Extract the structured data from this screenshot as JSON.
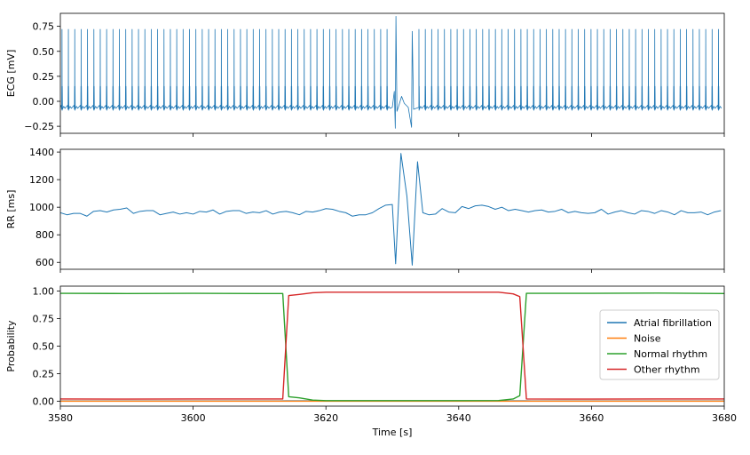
{
  "chart_data": [
    {
      "type": "line",
      "ylabel": "ECG [mV]",
      "xlim": [
        3580,
        3680
      ],
      "ylim": [
        -0.32,
        0.88
      ],
      "yticks": [
        -0.25,
        0.0,
        0.25,
        0.5,
        0.75
      ],
      "ytick_labels": [
        "−0.25",
        "0.00",
        "0.25",
        "0.50",
        "0.75"
      ],
      "color": "#1f77b4",
      "beat_interval_s": 0.96,
      "r_peak_mV": 0.72,
      "qrs_low_mV": 0.15,
      "baseline_mV": -0.06,
      "artifact_window_s": [
        3630,
        3634
      ],
      "artifact_peaks_mV": [
        0.85,
        -0.27,
        -0.26
      ]
    },
    {
      "type": "line",
      "ylabel": "RR [ms]",
      "xlim": [
        3580,
        3680
      ],
      "ylim": [
        550,
        1420
      ],
      "yticks": [
        600,
        800,
        1000,
        1200,
        1400
      ],
      "ytick_labels": [
        "600",
        "800",
        "1000",
        "1200",
        "1400"
      ],
      "color": "#1f77b4",
      "x": [
        3580,
        3581,
        3582,
        3583,
        3584,
        3585,
        3586,
        3587,
        3588,
        3589,
        3590,
        3591,
        3592,
        3593,
        3594,
        3595,
        3596,
        3597,
        3598,
        3599,
        3600,
        3601,
        3602,
        3603,
        3604,
        3605,
        3606,
        3607,
        3608,
        3609,
        3610,
        3611,
        3612,
        3613,
        3614,
        3615,
        3616,
        3617,
        3618,
        3619,
        3620,
        3621,
        3622,
        3623,
        3624,
        3625,
        3626,
        3627,
        3628,
        3629,
        3630,
        3630.5,
        3631.3,
        3632.2,
        3633.0,
        3633.8,
        3634.6,
        3635.5,
        3636.5,
        3637.5,
        3638.5,
        3639.5,
        3640.5,
        3641.5,
        3642.5,
        3643.5,
        3644.5,
        3645.5,
        3646.5,
        3647.5,
        3648.5,
        3649.5,
        3650.5,
        3651.5,
        3652.5,
        3653.5,
        3654.5,
        3655.5,
        3656.5,
        3657.5,
        3658.5,
        3659.5,
        3660.5,
        3661.5,
        3662.5,
        3663.5,
        3664.5,
        3665.5,
        3666.5,
        3667.5,
        3668.5,
        3669.5,
        3670.5,
        3671.5,
        3672.5,
        3673.5,
        3674.5,
        3675.5,
        3676.5,
        3677.5,
        3678.5,
        3679.5
      ],
      "y": [
        960,
        945,
        955,
        955,
        935,
        970,
        975,
        965,
        980,
        985,
        995,
        955,
        970,
        975,
        975,
        945,
        955,
        965,
        950,
        960,
        950,
        970,
        965,
        980,
        950,
        970,
        975,
        975,
        955,
        965,
        960,
        975,
        950,
        965,
        970,
        960,
        945,
        970,
        965,
        975,
        990,
        985,
        970,
        960,
        935,
        945,
        945,
        960,
        990,
        1015,
        1020,
        590,
        1390,
        1080,
        580,
        1330,
        960,
        945,
        950,
        990,
        965,
        960,
        1005,
        990,
        1010,
        1015,
        1005,
        985,
        1000,
        975,
        985,
        975,
        965,
        975,
        980,
        965,
        970,
        985,
        960,
        970,
        960,
        955,
        960,
        985,
        950,
        965,
        975,
        960,
        950,
        975,
        970,
        955,
        975,
        965,
        945,
        975,
        960,
        960,
        965,
        945,
        965,
        975
      ]
    },
    {
      "type": "line",
      "ylabel": "Probability",
      "xlabel": "Time [s]",
      "xlim": [
        3580,
        3680
      ],
      "ylim": [
        -0.045,
        1.045
      ],
      "xticks": [
        3580,
        3600,
        3620,
        3640,
        3660,
        3680
      ],
      "xtick_labels": [
        "3580",
        "3600",
        "3620",
        "3640",
        "3660",
        "3680"
      ],
      "yticks": [
        0.0,
        0.25,
        0.5,
        0.75,
        1.0
      ],
      "ytick_labels": [
        "0.00",
        "0.25",
        "0.50",
        "0.75",
        "1.00"
      ],
      "legend_position": "center-right",
      "series": [
        {
          "name": "Atrial fibrillation",
          "color": "#1f77b4",
          "x": [
            3580,
            3613,
            3614,
            3615,
            3648,
            3649,
            3650,
            3651,
            3680
          ],
          "y": [
            0.002,
            0.002,
            0.003,
            0.003,
            0.003,
            0.003,
            0.003,
            0.002,
            0.002
          ]
        },
        {
          "name": "Noise",
          "color": "#ff7f0e",
          "x": [
            3580,
            3680
          ],
          "y": [
            0.0,
            0.0
          ]
        },
        {
          "name": "Normal rhythm",
          "color": "#2ca02c",
          "x": [
            3580,
            3590,
            3600,
            3610,
            3613.5,
            3614.4,
            3616,
            3618,
            3620,
            3630,
            3640,
            3646,
            3648.2,
            3649.2,
            3650.2,
            3660,
            3670,
            3680
          ],
          "y": [
            0.98,
            0.978,
            0.98,
            0.978,
            0.978,
            0.04,
            0.03,
            0.01,
            0.005,
            0.005,
            0.005,
            0.006,
            0.02,
            0.05,
            0.98,
            0.98,
            0.982,
            0.978
          ],
          "note": "green"
        },
        {
          "name": "Other rhythm",
          "color": "#d62728",
          "x": [
            3580,
            3590,
            3600,
            3610,
            3613.5,
            3614.4,
            3616,
            3618,
            3620,
            3630,
            3640,
            3646,
            3648.2,
            3649.2,
            3650.2,
            3660,
            3670,
            3680
          ],
          "y": [
            0.02,
            0.019,
            0.02,
            0.02,
            0.02,
            0.96,
            0.97,
            0.985,
            0.99,
            0.99,
            0.99,
            0.99,
            0.975,
            0.95,
            0.02,
            0.019,
            0.02,
            0.02
          ]
        }
      ]
    }
  ]
}
